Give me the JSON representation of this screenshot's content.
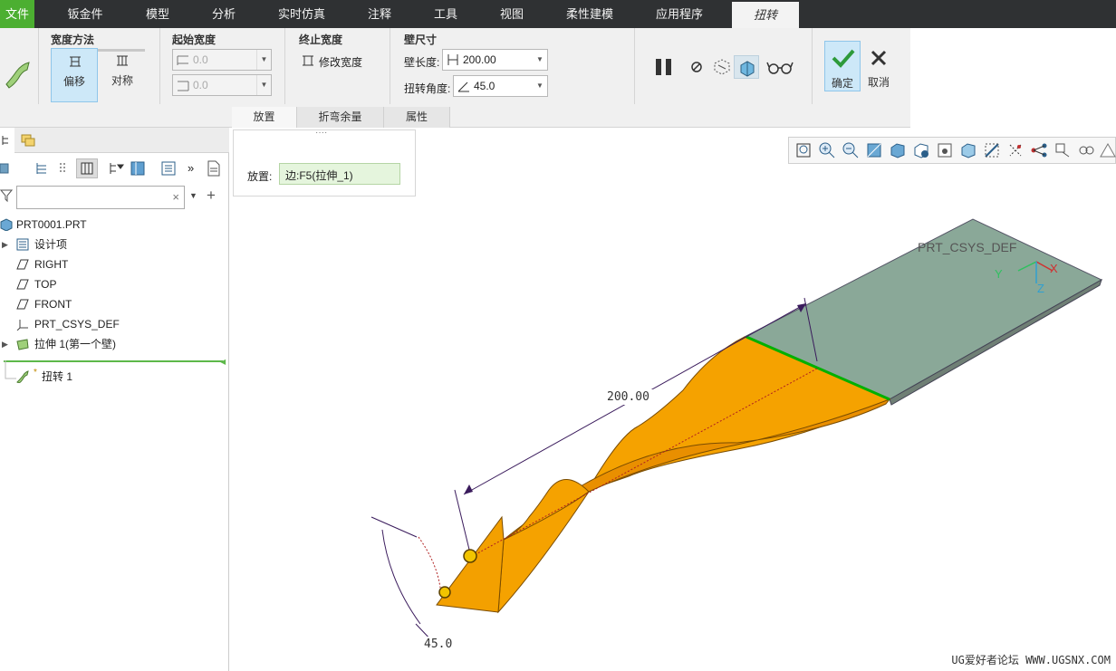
{
  "tabs": [
    "文件",
    "钣金件",
    "模型",
    "分析",
    "实时仿真",
    "注释",
    "工具",
    "视图",
    "柔性建模",
    "应用程序",
    "扭转"
  ],
  "ribbon": {
    "width_method": {
      "title": "宽度方法",
      "offset": "偏移",
      "symmetric": "对称"
    },
    "start_width": {
      "title": "起始宽度",
      "value1": "0.0",
      "value2": "0.0"
    },
    "end_width": {
      "title": "终止宽度",
      "modify": "修改宽度"
    },
    "wall_size": {
      "title": "壁尺寸",
      "length_label": "壁长度:",
      "length_value": "200.00",
      "angle_label": "扭转角度:",
      "angle_value": "45.0"
    },
    "ok": "确定",
    "cancel": "取消",
    "subtabs": [
      "放置",
      "折弯余量",
      "属性"
    ]
  },
  "placement": {
    "label": "放置:",
    "value": "边:F5(拉伸_1)",
    "handle": "····"
  },
  "tree": {
    "filter_placeholder": "",
    "items": [
      {
        "label": "PRT0001.PRT",
        "icon": "part-icon"
      },
      {
        "label": "设计项",
        "icon": "design-items-icon"
      },
      {
        "label": "RIGHT",
        "icon": "datum-plane-icon"
      },
      {
        "label": "TOP",
        "icon": "datum-plane-icon"
      },
      {
        "label": "FRONT",
        "icon": "datum-plane-icon"
      },
      {
        "label": "PRT_CSYS_DEF",
        "icon": "csys-icon"
      },
      {
        "label": "拉伸 1(第一个壁)",
        "icon": "extrude-wall-icon"
      },
      {
        "label": "扭转 1",
        "icon": "twist-icon"
      }
    ]
  },
  "model": {
    "csys_label": "PRT_CSYS_DEF",
    "axis_x": "X",
    "axis_y": "Y",
    "axis_z": "Z",
    "dim_length": "200.00",
    "dim_angle": "45.0",
    "colors": {
      "twist": "#f5a200",
      "flat": "#8aa898",
      "edge": "#00b000"
    }
  },
  "watermark": "UG爱好者论坛 WWW.UGSNX.COM"
}
